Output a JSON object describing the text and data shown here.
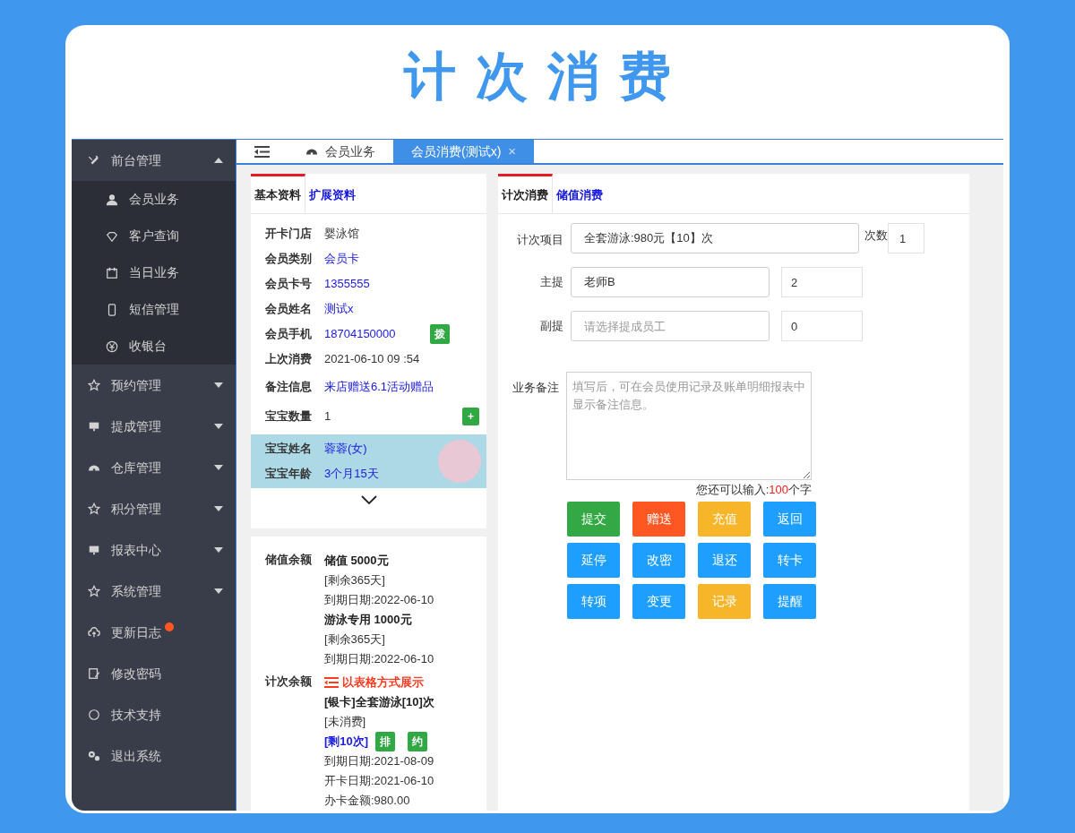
{
  "banner_title": "计次消费",
  "sidebar": {
    "items": [
      {
        "label": "前台管理",
        "expanded": true,
        "new": false,
        "children": [
          {
            "label": "会员业务"
          },
          {
            "label": "客户查询"
          },
          {
            "label": "当日业务"
          },
          {
            "label": "短信管理"
          },
          {
            "label": "收银台"
          }
        ]
      },
      {
        "label": "预约管理",
        "expanded": false,
        "new": false
      },
      {
        "label": "提成管理",
        "expanded": false,
        "new": false
      },
      {
        "label": "仓库管理",
        "expanded": false,
        "new": false
      },
      {
        "label": "积分管理",
        "expanded": false,
        "new": false
      },
      {
        "label": "报表中心",
        "expanded": false,
        "new": false
      },
      {
        "label": "系统管理",
        "expanded": false,
        "new": false
      },
      {
        "label": "更新日志",
        "new": true
      },
      {
        "label": "修改密码",
        "new": false
      },
      {
        "label": "技术支持",
        "new": false
      },
      {
        "label": "退出系统",
        "new": false
      }
    ]
  },
  "main_tabs": [
    {
      "label": "会员业务",
      "selected": false
    },
    {
      "label": "会员消费(测试x)",
      "selected": true,
      "close": "×"
    }
  ],
  "member_panel": {
    "tabs": [
      {
        "label": "基本资料",
        "selected": true
      },
      {
        "label": "扩展资料",
        "selected": false
      }
    ],
    "fields": [
      {
        "label": "开卡门店",
        "value": "婴泳馆",
        "kind": "plain"
      },
      {
        "label": "会员类别",
        "value": "会员卡",
        "kind": "link"
      },
      {
        "label": "会员卡号",
        "value": "1355555",
        "kind": "link"
      },
      {
        "label": "会员姓名",
        "value": "测试x",
        "kind": "link"
      },
      {
        "label": "会员手机",
        "value": "18704150000",
        "kind": "link",
        "action": "拨"
      },
      {
        "label": "上次消费",
        "value": "2021-06-10 09 :54",
        "kind": "plain"
      },
      {
        "label": "备注信息",
        "value": "来店赠送6.1活动赠品",
        "kind": "link"
      },
      {
        "label": "宝宝数量",
        "value": "1",
        "kind": "plain",
        "action": "+"
      }
    ],
    "baby": [
      {
        "label": "宝宝姓名",
        "value": "蓉蓉(女)"
      },
      {
        "label": "宝宝年龄",
        "value": "3个月15天"
      }
    ]
  },
  "balance_panel": {
    "stored_label": "储值余额",
    "stored": [
      {
        "title": "储值 5000元",
        "lines": [
          "[剩余365天]",
          "到期日期:2022-06-10"
        ]
      },
      {
        "title": "游泳专用 1000元",
        "lines": [
          "[剩余365天]",
          "到期日期:2022-06-10"
        ]
      }
    ],
    "count_label": "计次余额",
    "table_link": "以表格方式展示",
    "counts": [
      {
        "title": "[银卡]全套游泳[10]次",
        "status": "[未消费]",
        "remaining": "[剩10次]",
        "buttons": [
          "排",
          "约"
        ],
        "lines": [
          "到期日期:2021-08-09",
          "开卡日期:2021-06-10",
          "办卡金额:980.00"
        ]
      }
    ]
  },
  "consume_panel": {
    "tabs": [
      {
        "label": "计次消费",
        "selected": true
      },
      {
        "label": "储值消费",
        "selected": false
      }
    ],
    "item": {
      "label": "计次项目",
      "value": "全套游泳:980元【10】次",
      "count_label": "次数",
      "count": "1"
    },
    "staff": [
      {
        "label": "主提",
        "value": "老师B",
        "share": "2"
      },
      {
        "label": "副提",
        "placeholder": "请选择提成员工",
        "share": "0"
      }
    ],
    "note": {
      "label": "业务备注",
      "placeholder": "填写后，可在会员使用记录及账单明细报表中显示备注信息。"
    },
    "counter": {
      "before": "您还可以输入:",
      "count": "100",
      "after": "个字"
    },
    "buttons": [
      {
        "label": "提交",
        "color": "#33a845"
      },
      {
        "label": "赠送",
        "color": "#ff5722"
      },
      {
        "label": "充值",
        "color": "#f7b52a"
      },
      {
        "label": "返回",
        "color": "#1e9fff"
      },
      {
        "label": "延停",
        "color": "#1e9fff"
      },
      {
        "label": "改密",
        "color": "#1e9fff"
      },
      {
        "label": "退还",
        "color": "#1e9fff"
      },
      {
        "label": "转卡",
        "color": "#1e9fff"
      },
      {
        "label": "转项",
        "color": "#1e9fff"
      },
      {
        "label": "变更",
        "color": "#1e9fff"
      },
      {
        "label": "记录",
        "color": "#f7b52a"
      },
      {
        "label": "提醒",
        "color": "#1e9fff"
      }
    ]
  }
}
